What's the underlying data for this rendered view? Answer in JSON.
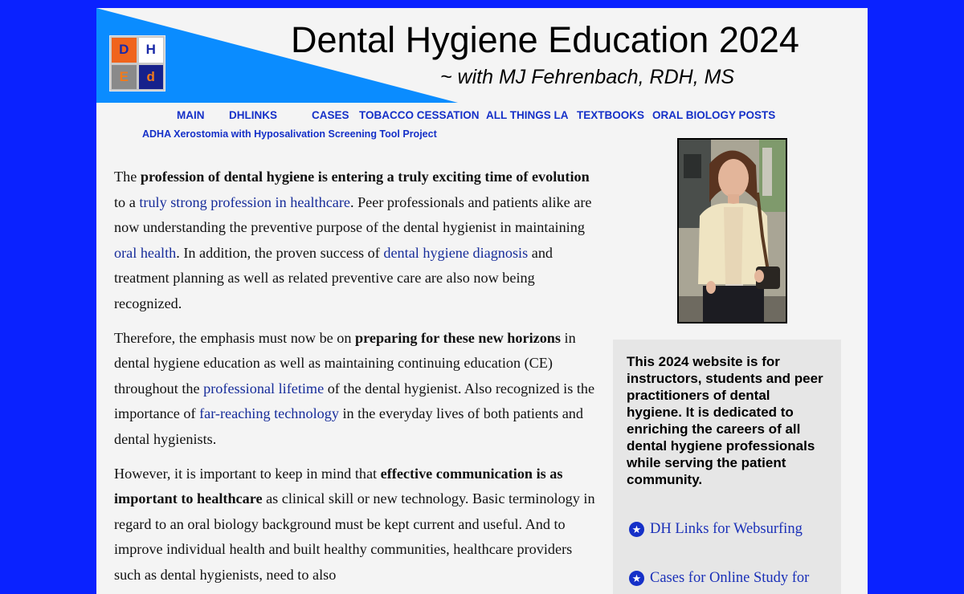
{
  "header": {
    "title": "Dental Hygiene Education 2024",
    "subtitle": "~ with MJ Fehrenbach, RDH, MS",
    "logo_letters": [
      "D",
      "H",
      "E",
      "d"
    ]
  },
  "nav": {
    "items": [
      "MAIN",
      "DHLINKS",
      "CASES",
      "TOBACCO CESSATION",
      "ALL THINGS LA",
      "TEXTBOOKS",
      "ORAL BIOLOGY POSTS"
    ],
    "sub_link": "ADHA Xerostomia with Hyposalivation Screening Tool Project"
  },
  "content": {
    "p1": [
      "The ",
      "profession of dental hygiene is entering a truly exciting time of evolution",
      " to a ",
      "truly strong profession in healthcare",
      ". Peer professionals and patients alike are now understanding the preventive purpose of the dental hygienist in maintaining ",
      "oral health",
      ". In addition, the proven success of ",
      "dental hygiene diagnosis",
      " and treatment planning as well as related preventive care are also now being recognized."
    ],
    "p2": [
      "Therefore, the emphasis must now be on ",
      "preparing for these new horizons",
      " in dental hygiene education as well as maintaining continuing education (CE) throughout the ",
      "professional lifetime",
      " of the dental hygienist. Also recognized is the importance of ",
      "far-reaching technology",
      " in the everyday lives of both patients and dental hygienists."
    ],
    "p3": [
      "However, it is important to keep in mind that ",
      "effective communication is as important to healthcare",
      " as clinical skill or new technology. Basic terminology in regard to an oral biology background must be kept current and useful. And to improve individual health and built healthy communities, healthcare providers such as dental hygienists, need to also "
    ]
  },
  "aside": {
    "description": "This 2024 website is for instructors, students and peer practitioners of dental hygiene. It is dedicated to enriching the careers of all dental hygiene professionals while serving the patient community.",
    "links": [
      "DH Links for Websurfing",
      "Cases for Online Study for"
    ]
  },
  "colors": {
    "page_background": "#0a22ff",
    "banner_blue": "#0a8cff",
    "link": "#1530c8",
    "panel": "#f4f4f4"
  },
  "icons": [
    "star-icon"
  ]
}
